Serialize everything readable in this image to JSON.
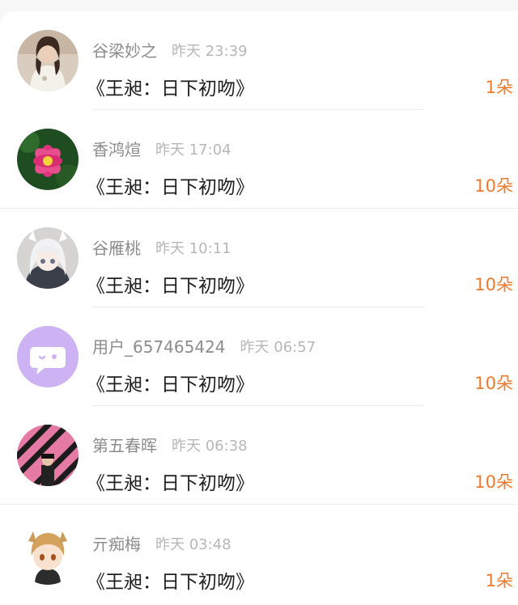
{
  "entries": [
    {
      "username": "谷梁妙之",
      "time": "昨天 23:39",
      "title": "《王昶：日下初吻》",
      "count": "1朵",
      "avatar": "photo-girl"
    },
    {
      "username": "香鸿煊",
      "time": "昨天 17:04",
      "title": "《王昶：日下初吻》",
      "count": "10朵",
      "avatar": "lotus-flower"
    },
    {
      "username": "谷雁桃",
      "time": "昨天 10:11",
      "title": "《王昶：日下初吻》",
      "count": "10朵",
      "avatar": "anime-girl"
    },
    {
      "username": "用户_657465424",
      "time": "昨天 06:57",
      "title": "《王昶：日下初吻》",
      "count": "10朵",
      "avatar": "default-chat-bubble"
    },
    {
      "username": "第五春晖",
      "time": "昨天 06:38",
      "title": "《王昶：日下初吻》",
      "count": "10朵",
      "avatar": "striped-person"
    },
    {
      "username": "亓痴梅",
      "time": "昨天 03:48",
      "title": "《王昶：日下初吻》",
      "count": "1朵",
      "avatar": "anime-boy"
    }
  ],
  "colors": {
    "count": "#f07a2b",
    "username": "#8c8c8c",
    "time": "#b7b7b7",
    "title": "#1e1e1e",
    "default_avatar": "#cfb5f5"
  }
}
